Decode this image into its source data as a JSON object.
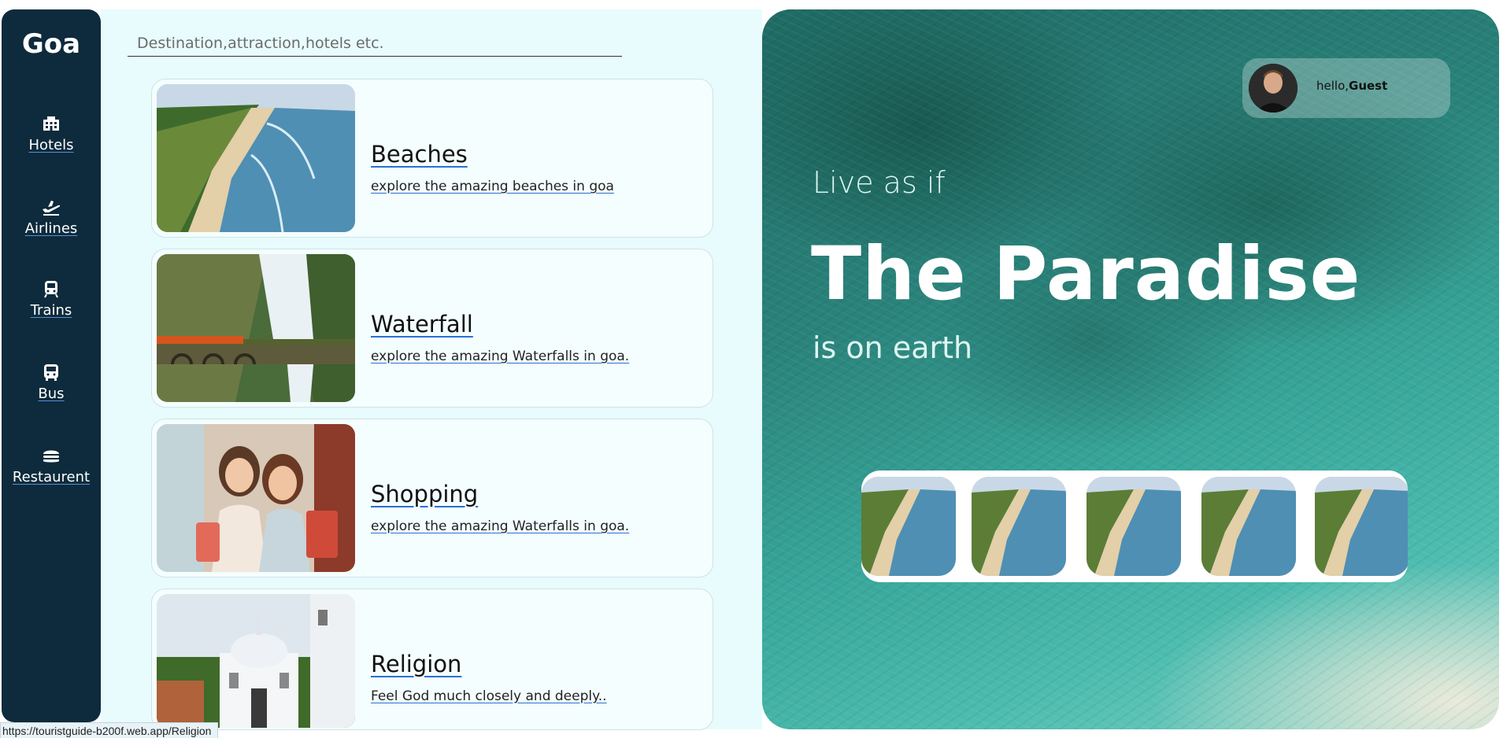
{
  "sidebar": {
    "brand": "Goa",
    "items": [
      {
        "label": "Hotels",
        "icon": "hotel-icon"
      },
      {
        "label": "Airlines",
        "icon": "plane-icon"
      },
      {
        "label": "Trains",
        "icon": "train-icon"
      },
      {
        "label": "Bus",
        "icon": "bus-icon"
      },
      {
        "label": "Restaurent",
        "icon": "burger-icon"
      }
    ]
  },
  "search": {
    "placeholder": "Destination,attraction,hotels etc.",
    "value": ""
  },
  "cards": [
    {
      "title": "Beaches",
      "desc": "explore the amazing beaches in goa",
      "image": "beach-image"
    },
    {
      "title": "Waterfall",
      "desc": "explore the amazing Waterfalls in goa.",
      "image": "waterfall-image"
    },
    {
      "title": "Shopping",
      "desc": "explore the amazing Waterfalls in goa.",
      "image": "shopping-image"
    },
    {
      "title": "Religion",
      "desc": "Feel God much closely and deeply..",
      "image": "church-image"
    }
  ],
  "hero": {
    "greeting_prefix": "hello,",
    "greeting_name": "Guest",
    "line1": "Live as if",
    "headline": "The Paradise",
    "line3": "is on earth",
    "gallery_count": 5
  },
  "status_url": "https://touristguide-b200f.web.app/Religion",
  "colors": {
    "sidebar": "#0d2b3c",
    "panel": "#e8fbfd",
    "card": "#f4fefe",
    "link_underline": "#2a6fd6",
    "hero_sea": "#2a837b"
  }
}
